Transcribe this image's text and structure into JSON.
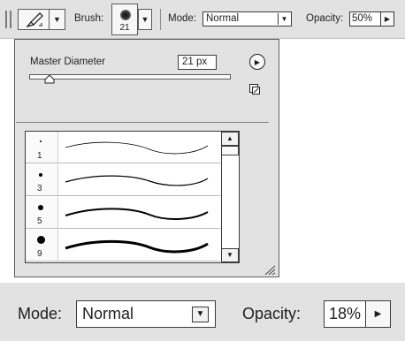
{
  "options_bar": {
    "brush_label": "Brush:",
    "brush_size": "21",
    "mode_label": "Mode:",
    "mode_value": "Normal",
    "opacity_label": "Opacity:",
    "opacity_value": "50%"
  },
  "brush_panel": {
    "master_diameter_label": "Master Diameter",
    "master_diameter_value": "21 px",
    "presets": [
      {
        "size": "1"
      },
      {
        "size": "3"
      },
      {
        "size": "5"
      },
      {
        "size": "9"
      }
    ]
  },
  "zoom_bar": {
    "mode_label": "Mode:",
    "mode_value": "Normal",
    "opacity_label": "Opacity:",
    "opacity_value": "18%"
  },
  "icons": {
    "tool": "brush-tool-icon",
    "dropdown": "dropdown-arrow-icon",
    "stepper": "right-triangle-icon",
    "panel_menu": "play-circle-icon",
    "new_preset": "new-preset-icon",
    "resize": "resize-grip-icon"
  }
}
